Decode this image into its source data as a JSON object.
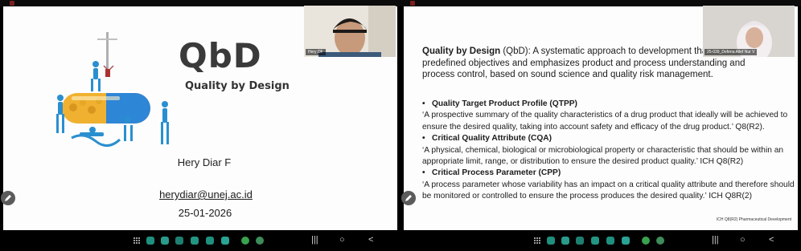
{
  "left_slide": {
    "logo": "QbD",
    "logo_subtitle": "Quality by Design",
    "presenter_name": "Hery Diar F",
    "email": "herydiar@unej.ac.id",
    "date": "25-01-2026"
  },
  "left_webcam": {
    "name": "Hery DF"
  },
  "right_webcam": {
    "name": "25-039_Defena Allef Nur V"
  },
  "right_slide": {
    "definition_term": "Quality by Design",
    "definition_text": " (QbD): A systematic approach to development that begins with predefined objectives and emphasizes product and process understanding and process control, based on sound science and quality risk management.",
    "items": [
      {
        "term": "Quality Target Product Profile (QTPP)",
        "text": "‘A prospective summary of the quality characteristics of a drug product that ideally will be achieved to ensure the desired quality, taking into account safety and efficacy of the drug product.’ Q8(R2)."
      },
      {
        "term": "Critical Quality Attribute (CQA)",
        "text": "‘A physical, chemical, biological or microbiological property or characteristic that should be within an appropriate limit, range, or distribution to ensure the desired product quality.’ ICH Q8(R2)"
      },
      {
        "term": "Critical Process Parameter (CPP)",
        "text": "‘A process parameter whose variability has an impact on a critical quality attribute and therefore should be monitored or controlled to ensure the process produces the desired quality.’ ICH Q8R(2)"
      }
    ],
    "footnote": "ICH Q8(R2) Pharmaceutical Development"
  },
  "taskbar_icons": [
    "apps-grid-icon",
    "app-icon-1",
    "app-icon-2",
    "app-icon-3",
    "app-icon-4",
    "app-icon-5",
    "app-icon-6",
    "whatsapp-icon",
    "chrome-icon"
  ],
  "nav": {
    "recents": "|||",
    "home": "○",
    "back": "<"
  },
  "colors": {
    "app_teal": "#1f8f7e",
    "app_green": "#39a24e"
  }
}
